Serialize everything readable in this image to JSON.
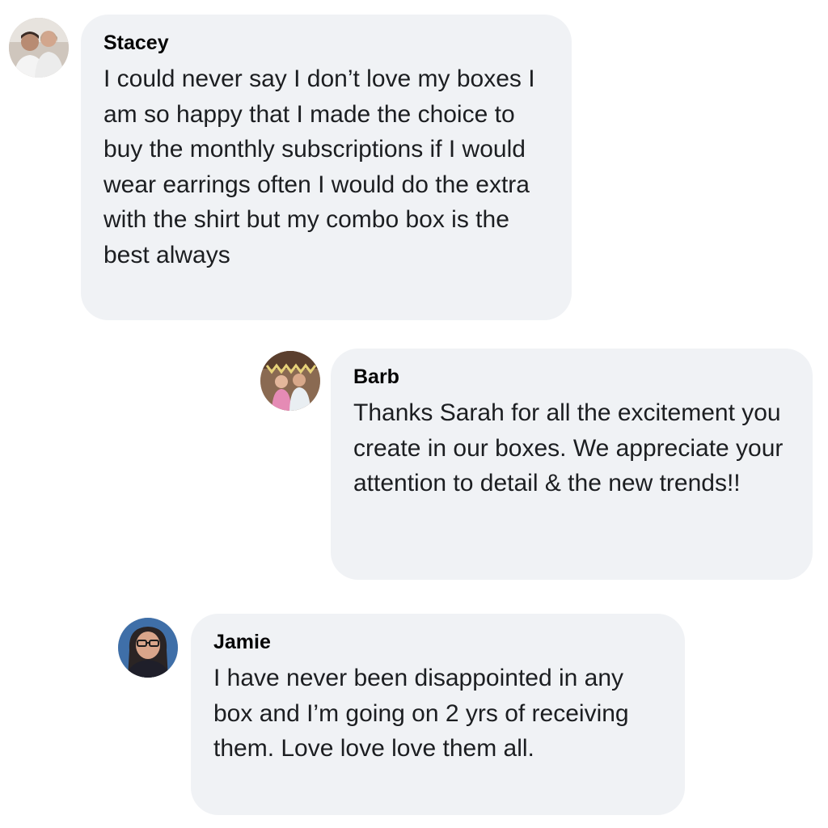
{
  "comments": [
    {
      "author": "Stacey",
      "avatar_icon": "profile-photo-couple",
      "text": "I could never say I don’t love my boxes I am so happy that I made the choice to buy the monthly subscriptions if I would wear earrings often I would do the extra with the shirt but my combo box is the best always"
    },
    {
      "author": "Barb",
      "avatar_icon": "profile-photo-group",
      "text": "Thanks Sarah for all the excitement you create in our boxes. We appreciate your attention to detail & the new trends!!"
    },
    {
      "author": "Jamie",
      "avatar_icon": "profile-photo-woman",
      "text": "I have never been disappointed in any box and I’m going on 2 yrs of receiving them. Love love love them all."
    }
  ],
  "colors": {
    "bubble_bg": "#f0f2f5",
    "author_text": "#050505",
    "body_text": "#1c1e21"
  }
}
